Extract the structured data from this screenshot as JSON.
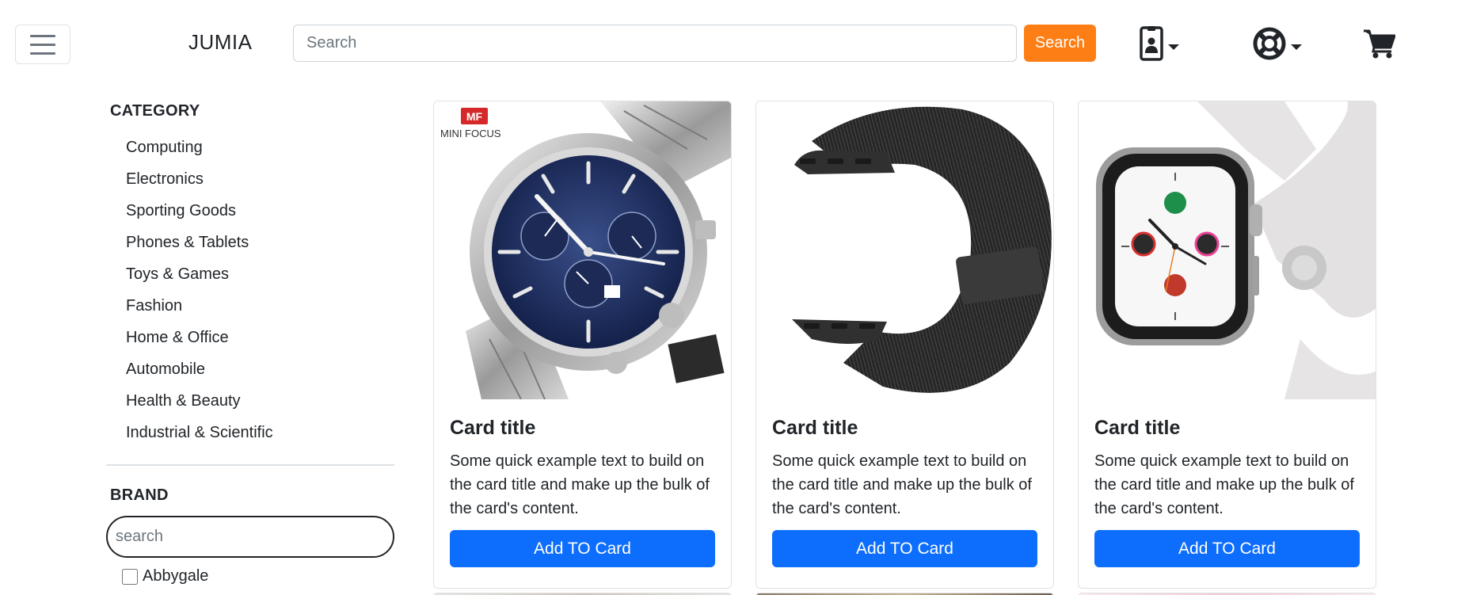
{
  "navbar": {
    "brand": "JUMIA",
    "search_placeholder": "Search",
    "search_button": "Search",
    "account_icon": "id-card-icon",
    "help_icon": "life-ring-icon",
    "cart_icon": "cart-icon"
  },
  "sidebar": {
    "category_heading": "CATEGORY",
    "categories": [
      "Computing",
      "Electronics",
      "Sporting Goods",
      "Phones & Tablets",
      "Toys & Games",
      "Fashion",
      "Home & Office",
      "Automobile",
      "Health & Beauty",
      "Industrial & Scientific"
    ],
    "brand_heading": "BRAND",
    "brand_search_placeholder": "search",
    "brands": [
      "Abbygale"
    ]
  },
  "cards": [
    {
      "image_logo_badge": "MF",
      "image_logo_text": "MINI FOCUS",
      "title": "Card title",
      "text": "Some quick example text to build on the card title and make up the bulk of the card's content.",
      "button": "Add TO Card"
    },
    {
      "title": "Card title",
      "text": "Some quick example text to build on the card title and make up the bulk of the card's content.",
      "button": "Add TO Card"
    },
    {
      "title": "Card title",
      "text": "Some quick example text to build on the card title and make up the bulk of the card's content.",
      "button": "Add TO Card"
    }
  ],
  "colors": {
    "search_button": "#fd7e14",
    "card_button": "#0d6efd"
  }
}
